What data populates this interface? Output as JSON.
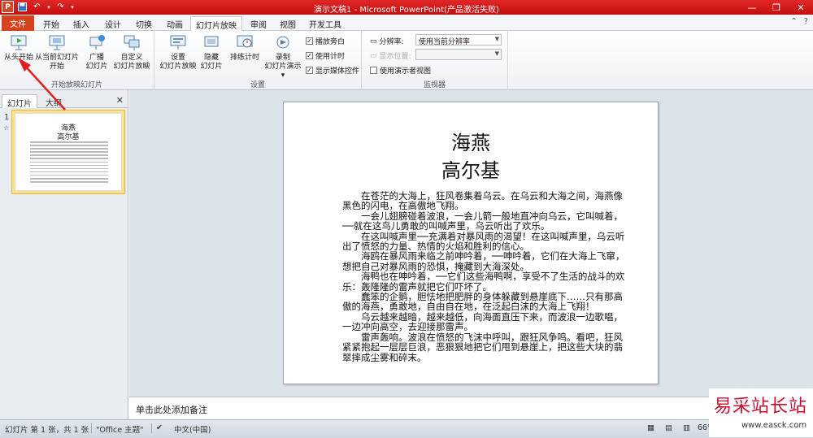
{
  "window": {
    "title": "演示文稿1 - Microsoft PowerPoint(产品激活失败)"
  },
  "quick_access": {
    "logo": "P"
  },
  "tabs": {
    "file": "文件",
    "items": [
      "开始",
      "插入",
      "设计",
      "切换",
      "动画",
      "幻灯片放映",
      "审阅",
      "视图",
      "开发工具"
    ],
    "active": "幻灯片放映"
  },
  "ribbon": {
    "group_start": {
      "label": "开始放映幻灯片",
      "from_beginning": "从头开始",
      "from_current_1": "从当前幻灯片",
      "from_current_2": "开始",
      "broadcast_1": "广播",
      "broadcast_2": "幻灯片",
      "custom_1": "自定义",
      "custom_2": "幻灯片放映"
    },
    "group_setup": {
      "label": "设置",
      "setup_1": "设置",
      "setup_2": "幻灯片放映",
      "hide_1": "隐藏",
      "hide_2": "幻灯片",
      "rehearse": "排练计时",
      "record_1": "录制",
      "record_2": "幻灯片演示",
      "play_narration": "播放旁白",
      "use_timings": "使用计时",
      "show_media_controls": "显示媒体控件"
    },
    "group_monitors": {
      "label": "监视器",
      "resolution_label": "分辨率:",
      "resolution_value": "使用当前分辨率",
      "show_on_label": "显示位置:",
      "presenter_view": "使用演示者视图"
    }
  },
  "left_panel": {
    "tab_slides": "幻灯片",
    "tab_outline": "大纲",
    "slide_number": "1",
    "thumb_title_1": "海燕",
    "thumb_title_2": "高尔基"
  },
  "slide": {
    "title_1": "海燕",
    "title_2": "高尔基",
    "paragraphs": [
      "在苍茫的大海上，狂风卷集着乌云。在乌云和大海之间，海燕像黑色的闪电，在高傲地飞翔。",
      "一会儿翅膀碰着波浪，一会儿箭一般地直冲向乌云，它叫喊着，──就在这鸟儿勇敢的叫喊声里，乌云听出了欢乐。",
      "在这叫喊声里──充满着对暴风雨的渴望！在这叫喊声里，乌云听出了愤怒的力量、热情的火焰和胜利的信心。",
      "海鸥在暴风雨来临之前呻吟着，──呻吟着，它们在大海上飞窜，想把自己对暴风雨的恐惧，掩藏到大海深处。",
      "海鸭也在呻吟着，──它们这些海鸭啊，享受不了生活的战斗的欢乐：轰隆隆的雷声就把它们吓坏了。",
      "蠢笨的企鹅，胆怯地把肥胖的身体躲藏到悬崖底下……只有那高傲的海燕，勇敢地，自由自在地，在泛起白沫的大海上飞翔！",
      "乌云越来越暗，越来越低，向海面直压下来，而波浪一边歌唱，一边冲向高空，去迎接那雷声。",
      "雷声轰响。波浪在愤怒的飞沫中呼叫，跟狂风争鸣。看吧，狂风紧紧抱起一层层巨浪，恶狠狠地把它们甩到悬崖上，把这些大块的翡翠摔成尘雾和碎末。"
    ]
  },
  "notes": {
    "placeholder": "单击此处添加备注"
  },
  "statusbar": {
    "slide_info": "幻灯片 第 1 张，共 1 张",
    "theme": "\"Office 主题\"",
    "language": "中文(中国)",
    "zoom": "66%"
  },
  "watermark": {
    "cn": "易采站长站",
    "en": "www.easck.com"
  },
  "colors": {
    "titlebar": "#d01818",
    "file_tab": "#d6421e",
    "thumb_highlight": "#fce08a",
    "annotation_arrow": "#e02020"
  }
}
